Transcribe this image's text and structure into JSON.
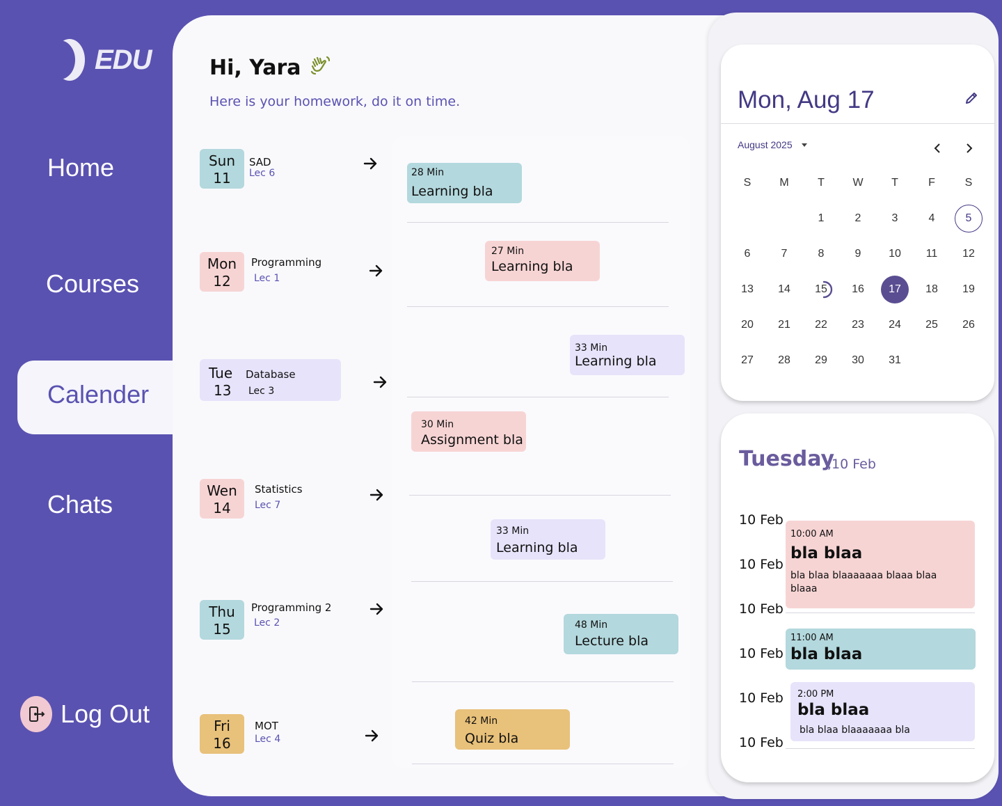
{
  "brand": {
    "name": "EDU"
  },
  "sidebar": {
    "items": [
      {
        "label": "Home"
      },
      {
        "label": "Courses"
      },
      {
        "label": "Calender",
        "active": true
      },
      {
        "label": "Chats"
      }
    ],
    "logout_label": "Log Out"
  },
  "header": {
    "greeting": "Hi, Yara",
    "subtitle": "Here is your homework, do it on time."
  },
  "days": [
    {
      "weekday": "Sun",
      "day": "11",
      "course": "SAD",
      "lecture": "Lec 6",
      "color": "#b3d8dd"
    },
    {
      "weekday": "Mon",
      "day": "12",
      "course": "Programming",
      "lecture": "Lec 1",
      "color": "#f7d4d4"
    },
    {
      "weekday": "Tue",
      "day": "13",
      "course": "Database",
      "lecture": "Lec 3",
      "color": "#e6e3fa"
    },
    {
      "weekday": "Wen",
      "day": "14",
      "course": "Statistics",
      "lecture": "Lec 7",
      "color": "#f7d4d4"
    },
    {
      "weekday": "Thu",
      "day": "15",
      "course": "Programming 2",
      "lecture": "Lec 2",
      "color": "#b3d8dd"
    },
    {
      "weekday": "Fri",
      "day": "16",
      "course": "MOT",
      "lecture": "Lec 4",
      "color": "#e8c17a"
    }
  ],
  "tasks": [
    {
      "duration": "28 Min",
      "title": "Learning bla",
      "color": "#b3d8dd"
    },
    {
      "duration": "27 Min",
      "title": "Learning bla",
      "color": "#f7d4d4"
    },
    {
      "duration": "33 Min",
      "title": "Learning bla",
      "color": "#e6e3fa"
    },
    {
      "duration": "30 Min",
      "title": "Assignment bla",
      "color": "#f7d4d4"
    },
    {
      "duration": "33 Min",
      "title": "Learning bla",
      "color": "#e6e3fa"
    },
    {
      "duration": "48 Min",
      "title": "Lecture bla",
      "color": "#b3d8dd"
    },
    {
      "duration": "42 Min",
      "title": "Quiz bla",
      "color": "#e8c17a"
    }
  ],
  "calendar": {
    "selected_label": "Mon, Aug 17",
    "month_label": "August 2025",
    "weekdays": [
      "S",
      "M",
      "T",
      "W",
      "T",
      "F",
      "S"
    ],
    "weeks": [
      [
        "",
        "",
        "1",
        "2",
        "3",
        "4",
        "5"
      ],
      [
        "6",
        "7",
        "8",
        "9",
        "10",
        "11",
        "12"
      ],
      [
        "13",
        "14",
        "15",
        "16",
        "17",
        "18",
        "19"
      ],
      [
        "20",
        "21",
        "22",
        "23",
        "24",
        "25",
        "26"
      ],
      [
        "27",
        "28",
        "29",
        "30",
        "31",
        "",
        ""
      ]
    ],
    "outlined_day": "5",
    "selected_day": "17",
    "loading_day": "15"
  },
  "schedule": {
    "day_name": "Tuesday",
    "date_label": ",10 Feb",
    "time_labels": [
      "10 Feb",
      "10 Feb",
      "10 Feb",
      "10 Feb",
      "10 Feb",
      "10 Feb"
    ],
    "events": [
      {
        "time": "10:00 AM",
        "title": "bla blaa",
        "desc": "bla blaa blaaaaaaa blaaa blaa blaaa",
        "color": "#f7d4d4"
      },
      {
        "time": "11:00 AM",
        "title": "bla blaa",
        "desc": "",
        "color": "#b3d8dd"
      },
      {
        "time": "2:00 PM",
        "title": "bla blaa",
        "desc": "bla blaa blaaaaaaa bla",
        "color": "#e6e3fa"
      }
    ]
  },
  "colors": {
    "brand": "#5a52b1",
    "panel": "#f9f9fc",
    "accent_dark": "#423984"
  },
  "icons": [
    "moon-logo-icon",
    "wave-hand-icon",
    "arrow-right-icon",
    "logout-door-icon",
    "pencil-icon",
    "chevron-left-icon",
    "chevron-right-icon",
    "caret-down-icon"
  ]
}
